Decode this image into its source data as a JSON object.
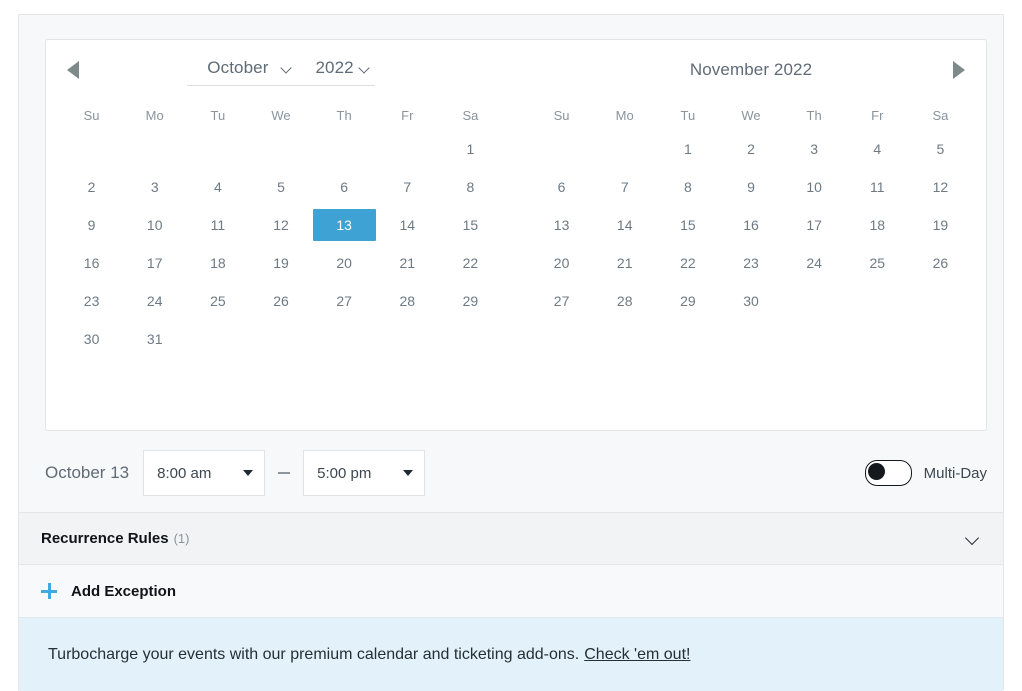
{
  "theme": {
    "accent_blue": "#3fa2d4",
    "plus_blue": "#3fa9e0",
    "banner_blue": "#e3f2fa",
    "panel_gray": "#f7f8f9",
    "band_gray": "#f2f3f5"
  },
  "calendars": [
    {
      "id": "left-calendar",
      "month_label": "October",
      "year_label": "2022",
      "has_month_select": true,
      "has_prev_arrow": true,
      "has_next_arrow": false,
      "weekdays": [
        "Su",
        "Mo",
        "Tu",
        "We",
        "Th",
        "Fr",
        "Sa"
      ],
      "weeks": [
        [
          "",
          "",
          "",
          "",
          "",
          "",
          "1"
        ],
        [
          "2",
          "3",
          "4",
          "5",
          "6",
          "7",
          "8"
        ],
        [
          "9",
          "10",
          "11",
          "12",
          "13",
          "14",
          "15"
        ],
        [
          "16",
          "17",
          "18",
          "19",
          "20",
          "21",
          "22"
        ],
        [
          "23",
          "24",
          "25",
          "26",
          "27",
          "28",
          "29"
        ],
        [
          "30",
          "31",
          "",
          "",
          "",
          "",
          ""
        ]
      ],
      "selected_day": "13"
    },
    {
      "id": "right-calendar",
      "title": "November 2022",
      "has_month_select": false,
      "has_prev_arrow": false,
      "has_next_arrow": true,
      "weekdays": [
        "Su",
        "Mo",
        "Tu",
        "We",
        "Th",
        "Fr",
        "Sa"
      ],
      "weeks": [
        [
          "",
          "",
          "1",
          "2",
          "3",
          "4",
          "5"
        ],
        [
          "6",
          "7",
          "8",
          "9",
          "10",
          "11",
          "12"
        ],
        [
          "13",
          "14",
          "15",
          "16",
          "17",
          "18",
          "19"
        ],
        [
          "20",
          "21",
          "22",
          "23",
          "24",
          "25",
          "26"
        ],
        [
          "27",
          "28",
          "29",
          "30",
          "",
          "",
          ""
        ]
      ],
      "selected_day": ""
    }
  ],
  "time_row": {
    "date_label": "October 13",
    "start_time": "8:00 am",
    "end_time": "5:00 pm",
    "separator": "",
    "multiday_label": "Multi-Day",
    "multiday_on": false
  },
  "recurrence": {
    "title": "Recurrence Rules",
    "count": "(1)"
  },
  "add_exception": {
    "label": "Add Exception"
  },
  "promo": {
    "text": "Turbocharge your events with our premium calendar and ticketing add-ons.",
    "link": "Check 'em out!"
  }
}
